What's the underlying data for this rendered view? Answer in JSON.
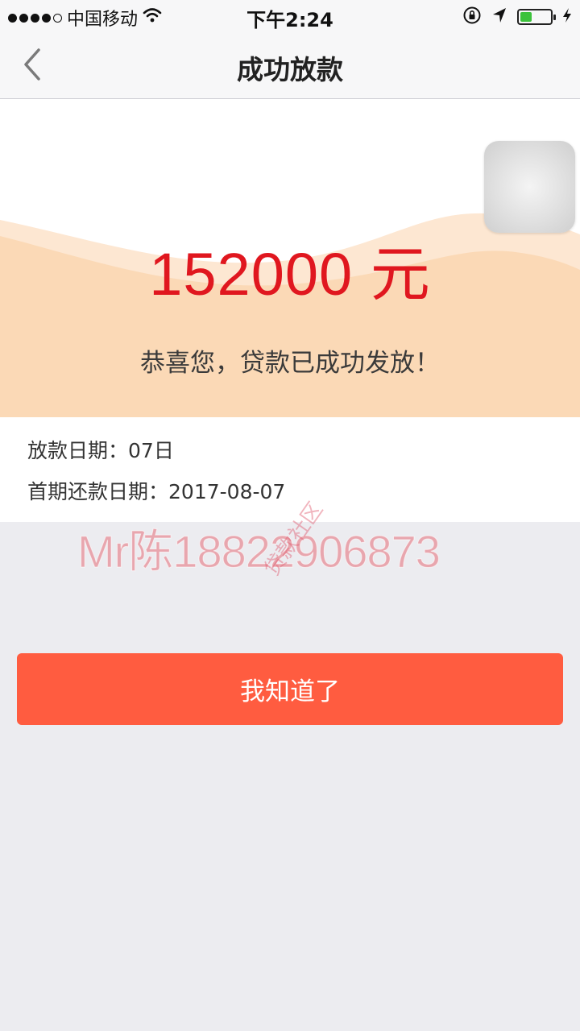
{
  "status_bar": {
    "carrier": "中国移动",
    "time": "下午2:24"
  },
  "nav": {
    "title": "成功放款"
  },
  "hero": {
    "amount": "152000 元",
    "message": "恭喜您，贷款已成功发放！"
  },
  "info": {
    "loan_date_label": "放款日期：",
    "loan_date_value": "07日",
    "first_repay_label": "首期还款日期：",
    "first_repay_value": "2017-08-07"
  },
  "watermark": {
    "text": "Mr陈18822906873",
    "diagonal_text": "贷款社区"
  },
  "actions": {
    "ok_label": "我知道了"
  },
  "colors": {
    "accent_button": "#ff5c40",
    "amount_red": "#e0171f",
    "wave_peach": "#fbd9b6"
  },
  "icons": {
    "back": "chevron-left-icon",
    "wifi": "wifi-icon",
    "lock": "orientation-lock-icon",
    "location": "location-arrow-icon",
    "battery": "battery-icon",
    "charging": "charging-bolt-icon"
  }
}
